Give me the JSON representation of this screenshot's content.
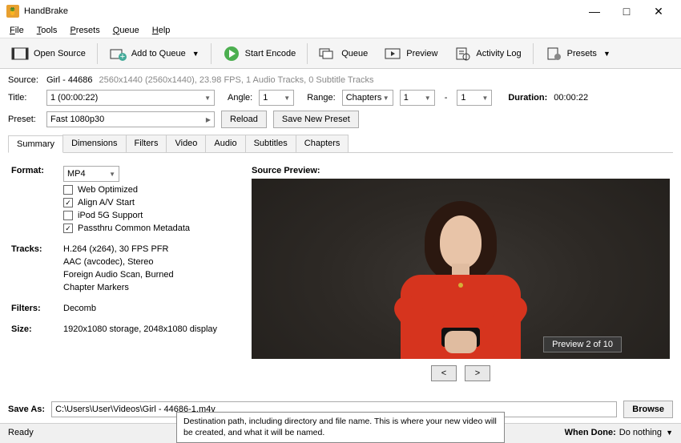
{
  "app": {
    "title": "HandBrake"
  },
  "win": {
    "min": "—",
    "max": "□",
    "close": "✕"
  },
  "menu": {
    "file": "File",
    "tools": "Tools",
    "presets": "Presets",
    "queue": "Queue",
    "help": "Help"
  },
  "toolbar": {
    "open_source": "Open Source",
    "add_queue": "Add to Queue",
    "start_encode": "Start Encode",
    "queue": "Queue",
    "preview": "Preview",
    "activity": "Activity Log",
    "presets": "Presets"
  },
  "source": {
    "label": "Source:",
    "name": "Girl - 44686",
    "meta": "2560x1440 (2560x1440), 23.98 FPS, 1 Audio Tracks, 0 Subtitle Tracks"
  },
  "title": {
    "label": "Title:",
    "value": "1  (00:00:22)"
  },
  "angle": {
    "label": "Angle:",
    "value": "1"
  },
  "range": {
    "label": "Range:",
    "type": "Chapters",
    "from": "1",
    "to": "1",
    "dash": "-"
  },
  "duration": {
    "label": "Duration:",
    "value": "00:00:22"
  },
  "preset": {
    "label": "Preset:",
    "value": "Fast 1080p30",
    "reload": "Reload",
    "save": "Save New Preset"
  },
  "tabs": [
    "Summary",
    "Dimensions",
    "Filters",
    "Video",
    "Audio",
    "Subtitles",
    "Chapters"
  ],
  "summary": {
    "format_label": "Format:",
    "format_value": "MP4",
    "web_opt": "Web Optimized",
    "align": "Align A/V Start",
    "ipod": "iPod 5G Support",
    "passthru": "Passthru Common Metadata",
    "tracks_label": "Tracks:",
    "tracks": [
      "H.264 (x264), 30 FPS PFR",
      "AAC (avcodec), Stereo",
      "Foreign Audio Scan, Burned",
      "Chapter Markers"
    ],
    "filters_label": "Filters:",
    "filters_value": "Decomb",
    "size_label": "Size:",
    "size_value": "1920x1080 storage, 2048x1080 display",
    "preview_label": "Source Preview:",
    "preview_badge": "Preview 2 of 10",
    "prev": "<",
    "next": ">"
  },
  "saveas": {
    "label": "Save As:",
    "value": "C:\\Users\\User\\Videos\\Girl - 44686-1.m4v",
    "browse": "Browse",
    "tooltip": "Destination path, including directory and file name. This is where your new video will be created, and what it will be named."
  },
  "status": {
    "ready": "Ready",
    "whendone_label": "When Done:",
    "whendone_value": "Do nothing"
  }
}
